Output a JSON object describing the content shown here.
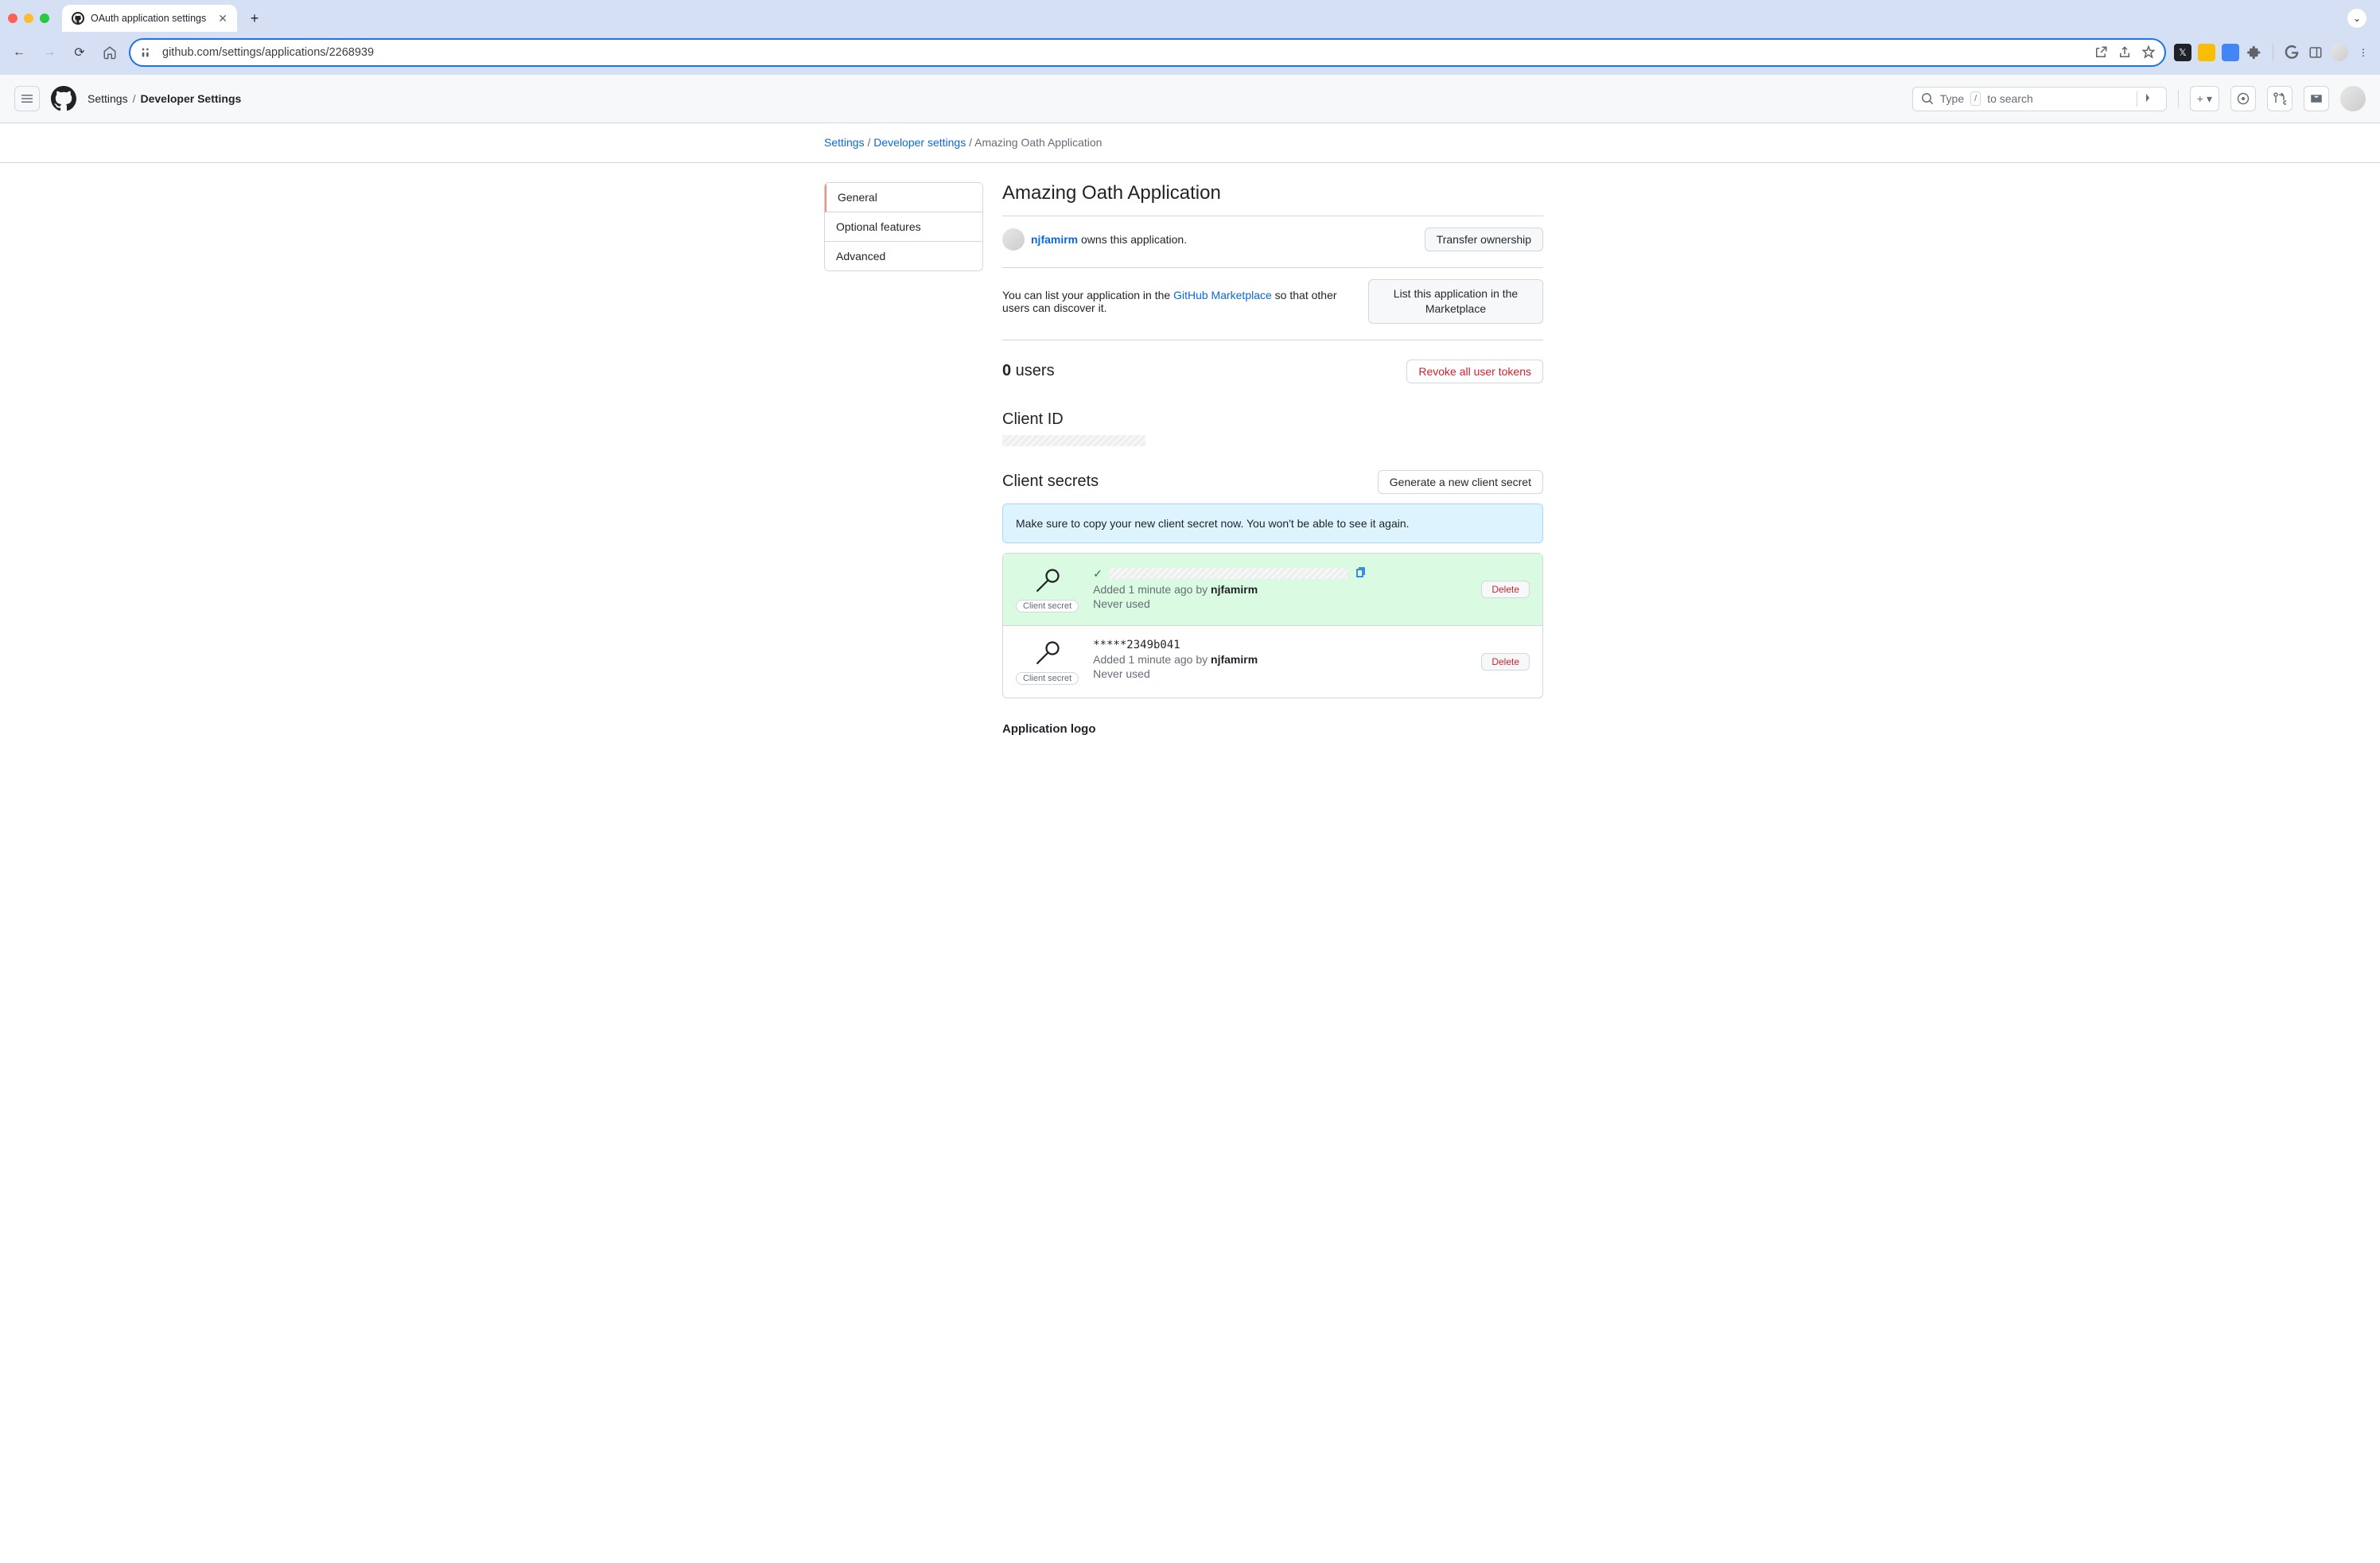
{
  "browser": {
    "tab_title": "OAuth application settings",
    "url": "github.com/settings/applications/2268939"
  },
  "gh_header": {
    "crumb1": "Settings",
    "crumb2": "Developer Settings",
    "search_prefix": "Type ",
    "search_key": "/",
    "search_suffix": " to search"
  },
  "breadcrumb": {
    "settings": "Settings",
    "dev_settings": "Developer settings",
    "current": "Amazing Oath Application"
  },
  "side_nav": {
    "general": "General",
    "optional": "Optional features",
    "advanced": "Advanced"
  },
  "page": {
    "title": "Amazing Oath Application",
    "owner_user": "njfamirm",
    "owner_suffix": " owns this application.",
    "transfer_btn": "Transfer ownership",
    "marketplace_pre": "You can list your application in the ",
    "marketplace_link": "GitHub Marketplace",
    "marketplace_post": " so that other users can discover it.",
    "list_btn": "List this application in the Marketplace",
    "users_count": "0",
    "users_label": " users",
    "revoke_btn": "Revoke all user tokens",
    "client_id_heading": "Client ID",
    "client_secrets_heading": "Client secrets",
    "generate_btn": "Generate a new client secret",
    "flash": "Make sure to copy your new client secret now. You won't be able to see it again.",
    "secret_pill": "Client secret",
    "secret1_added_pre": "Added 1 minute ago by ",
    "secret1_added_user": "njfamirm",
    "secret1_used": "Never used",
    "secret2_value": "*****2349b041",
    "secret2_added_pre": "Added 1 minute ago by ",
    "secret2_added_user": "njfamirm",
    "secret2_used": "Never used",
    "delete_btn": "Delete",
    "app_logo_heading": "Application logo"
  }
}
